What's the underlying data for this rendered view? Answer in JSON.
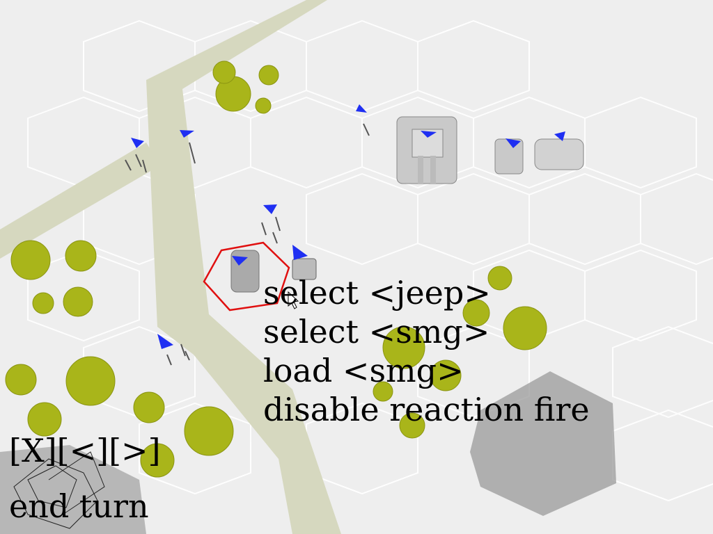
{
  "command_menu": [
    "select <jeep>",
    "select <smg>",
    "load <smg>",
    "disable reaction fire"
  ],
  "hud": {
    "close_label": "[X]",
    "prev_label": "[<]",
    "next_label": "[>]",
    "end_turn_label": "end turn"
  },
  "colors": {
    "ground": "#eeeeee",
    "road": "#d6d8bf",
    "tree": "#a9b51a",
    "team_marker": "#1f2ff2",
    "selection": "#e01010",
    "blocked_hex": "#999999"
  }
}
